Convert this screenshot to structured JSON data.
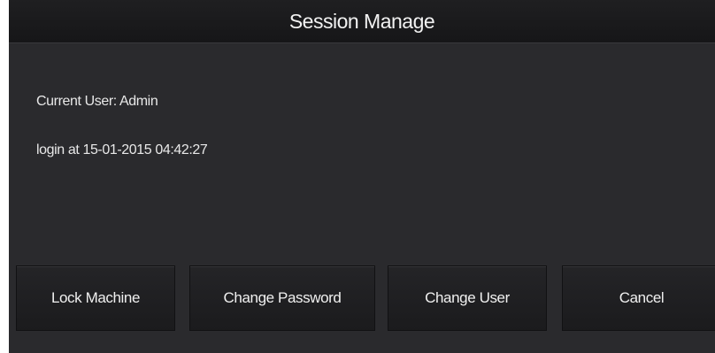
{
  "dialog": {
    "title": "Session Manage",
    "current_user": "Current User: Admin",
    "login_info": "login at 15-01-2015 04:42:27"
  },
  "buttons": {
    "lock_machine": "Lock Machine",
    "change_password": "Change Password",
    "change_user": "Change User",
    "cancel": "Cancel"
  }
}
